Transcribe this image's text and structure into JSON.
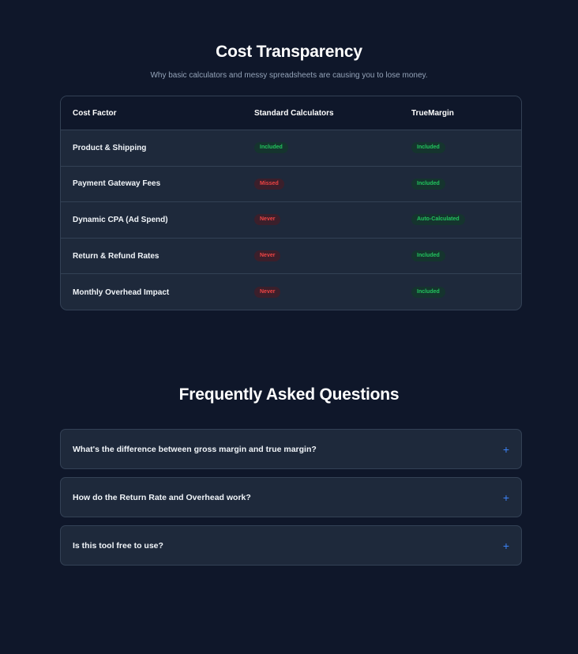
{
  "cost": {
    "title": "Cost Transparency",
    "subtitle": "Why basic calculators and messy spreadsheets are causing you to lose money.",
    "headers": [
      "Cost Factor",
      "Standard Calculators",
      "TrueMargin"
    ],
    "rows": [
      {
        "factor": "Product & Shipping",
        "standard": "Included",
        "truemargin": "Included"
      },
      {
        "factor": "Payment Gateway Fees",
        "standard": "Missed",
        "truemargin": "Included"
      },
      {
        "factor": "Dynamic CPA (Ad Spend)",
        "standard": "Never",
        "truemargin": "Auto-Calculated"
      },
      {
        "factor": "Return & Refund Rates",
        "standard": "Never",
        "truemargin": "Included"
      },
      {
        "factor": "Monthly Overhead Impact",
        "standard": "Never",
        "truemargin": "Included"
      }
    ]
  },
  "faq": {
    "title": "Frequently Asked Questions",
    "items": [
      {
        "question": "What's the difference between gross margin and true margin?",
        "icon": "+"
      },
      {
        "question": "How do the Return Rate and Overhead work?",
        "icon": "+"
      },
      {
        "question": "Is this tool free to use?",
        "icon": "+"
      }
    ]
  },
  "colors": {
    "background": "#0f172a",
    "card": "#1e293b",
    "positive": "#22c55e",
    "negative": "#ef4444",
    "accent": "#3b82f6"
  }
}
